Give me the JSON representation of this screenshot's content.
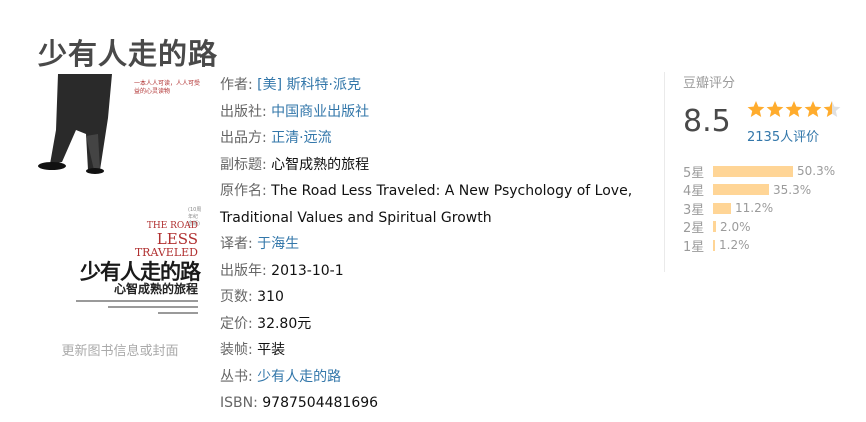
{
  "book": {
    "title": "少有人走的路"
  },
  "cover": {
    "tagline": "一本人人可读，人人可受益的心灵读物",
    "series_tag": "(10周年纪念版)",
    "en_line1": "THE ROAD",
    "en_line2": "LESS",
    "en_line3": "TRAVELED",
    "zh_title": "少有人走的路",
    "zh_subtitle": "心智成熟的旅程",
    "update_link": "更新图书信息或封面"
  },
  "info": {
    "author_label": "作者:",
    "author": "[美] 斯科特·派克",
    "publisher_label": "出版社:",
    "publisher": "中国商业出版社",
    "producer_label": "出品方:",
    "producer": "正清·远流",
    "subtitle_label": "副标题:",
    "subtitle": "心智成熟的旅程",
    "original_label": "原作名:",
    "original": "The Road Less Traveled: A New Psychology of Love, Traditional Values and Spiritual Growth",
    "translator_label": "译者:",
    "translator": "于海生",
    "pubdate_label": "出版年:",
    "pubdate": "2013-10-1",
    "pages_label": "页数:",
    "pages": "310",
    "price_label": "定价:",
    "price": "32.80元",
    "binding_label": "装帧:",
    "binding": "平装",
    "series_label": "丛书:",
    "series": "少有人走的路",
    "isbn_label": "ISBN:",
    "isbn": "9787504481696"
  },
  "rating": {
    "label": "豆瓣评分",
    "score": "8.5",
    "stars_value": 4.5,
    "count_text": "2135人评价",
    "star_color": "#ffac2d",
    "bar_color": "#ffd596",
    "breakdown": [
      {
        "label": "5星",
        "pct_text": "50.3%",
        "pct": 50.3
      },
      {
        "label": "4星",
        "pct_text": "35.3%",
        "pct": 35.3
      },
      {
        "label": "3星",
        "pct_text": "11.2%",
        "pct": 11.2
      },
      {
        "label": "2星",
        "pct_text": "2.0%",
        "pct": 2.0
      },
      {
        "label": "1星",
        "pct_text": "1.2%",
        "pct": 1.2
      }
    ]
  }
}
